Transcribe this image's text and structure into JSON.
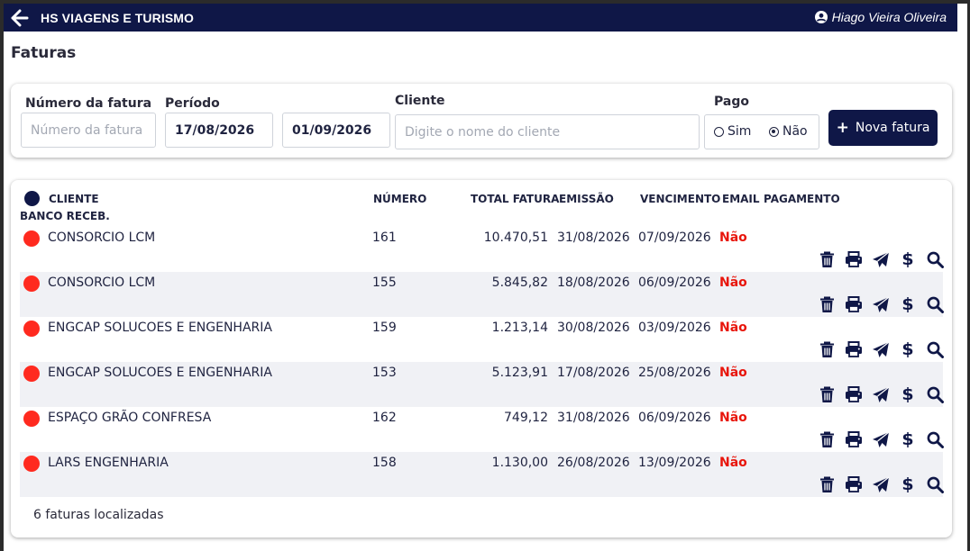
{
  "header": {
    "company": "HS VIAGENS E TURISMO",
    "user": "Hiago Vieira Oliveira"
  },
  "page": {
    "title": "Faturas"
  },
  "filters": {
    "numero_label": "Número da fatura",
    "numero_placeholder": "Número da fatura",
    "periodo_label": "Período",
    "periodo_inicio": "17/08/2026",
    "periodo_fim": "01/09/2026",
    "cliente_label": "Cliente",
    "cliente_placeholder": "Digite o nome do cliente",
    "pago_label": "Pago",
    "pago_sim": "Sim",
    "pago_nao": "Não",
    "pago_selected": "Não",
    "nova_fatura": "Nova fatura"
  },
  "table": {
    "headers": {
      "cliente": "CLIENTE",
      "banco": "BANCO RECEB.",
      "numero": "NÚMERO",
      "total": "TOTAL FATURA",
      "emissao": "EMISSÃO",
      "vencimento": "VENCIMENTO",
      "email": "EMAIL",
      "pagamento": "PAGAMENTO"
    },
    "rows": [
      {
        "cliente": "CONSORCIO LCM",
        "numero": "161",
        "total": "10.470,51",
        "emissao": "31/08/2026",
        "vencimento": "07/09/2026",
        "email": "Não"
      },
      {
        "cliente": "CONSORCIO LCM",
        "numero": "155",
        "total": "5.845,82",
        "emissao": "18/08/2026",
        "vencimento": "06/09/2026",
        "email": "Não"
      },
      {
        "cliente": "ENGCAP SOLUCOES E ENGENHARIA",
        "numero": "159",
        "total": "1.213,14",
        "emissao": "30/08/2026",
        "vencimento": "03/09/2026",
        "email": "Não"
      },
      {
        "cliente": "ENGCAP SOLUCOES E ENGENHARIA",
        "numero": "153",
        "total": "5.123,91",
        "emissao": "17/08/2026",
        "vencimento": "25/08/2026",
        "email": "Não"
      },
      {
        "cliente": "ESPAÇO GRÃO CONFRESA",
        "numero": "162",
        "total": "749,12",
        "emissao": "31/08/2026",
        "vencimento": "06/09/2026",
        "email": "Não"
      },
      {
        "cliente": "LARS ENGENHARIA",
        "numero": "158",
        "total": "1.130,00",
        "emissao": "26/08/2026",
        "vencimento": "13/09/2026",
        "email": "Não"
      }
    ],
    "status_color": "#ff2a1f",
    "email_color": "#e8150b",
    "row_actions": [
      "trash-icon",
      "print-icon",
      "send-icon",
      "dollar-icon",
      "search-icon"
    ],
    "dollar_glyph": "$",
    "footer": "6 faturas localizadas"
  },
  "colors": {
    "accent": "#0f1747"
  }
}
